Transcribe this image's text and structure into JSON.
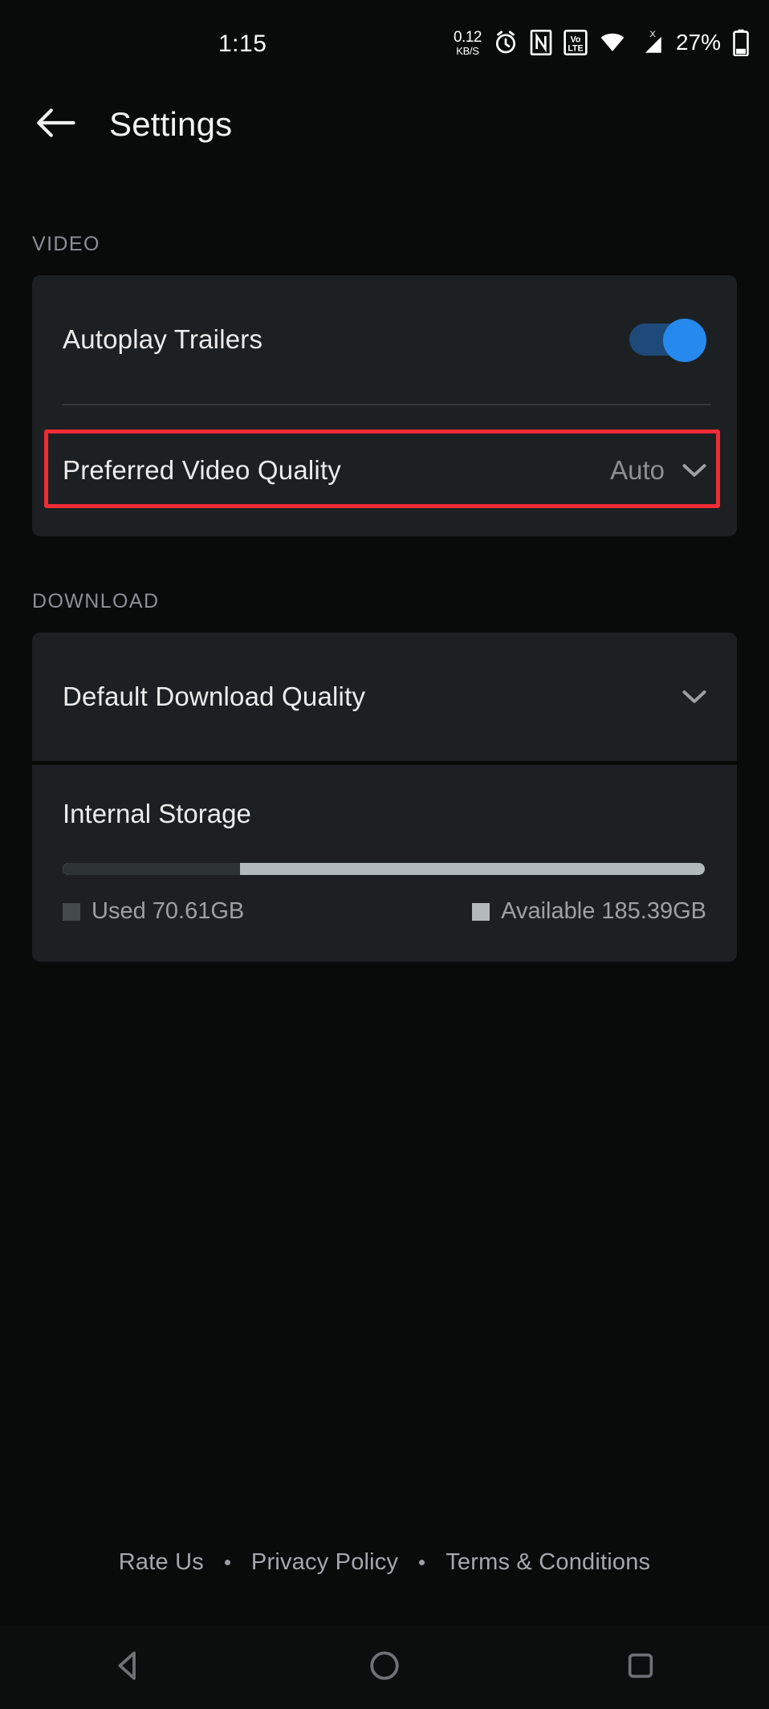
{
  "status_bar": {
    "time": "1:15",
    "network_speed_value": "0.12",
    "network_speed_unit": "KB/S",
    "alarm_icon": "alarm-clock-icon",
    "nfc_icon": "nfc-icon",
    "volte_icon": "volte-icon",
    "volte_top": "Vo",
    "volte_bottom": "LTE",
    "wifi_icon": "wifi-icon",
    "signal_icon": "cellular-signal-no-sim-icon",
    "signal_badge": "X",
    "battery_percent": "27%",
    "battery_icon": "battery-icon"
  },
  "appbar": {
    "back_icon": "arrow-left-icon",
    "title": "Settings"
  },
  "sections": [
    {
      "header": "VIDEO",
      "rows": [
        {
          "label": "Autoplay Trailers",
          "control": "toggle",
          "value": "",
          "toggle_on": true
        },
        {
          "label": "Preferred Video Quality",
          "control": "dropdown",
          "value": "Auto",
          "highlighted": true
        }
      ]
    },
    {
      "header": "DOWNLOAD",
      "rows": [
        {
          "label": "Default Download Quality",
          "control": "dropdown",
          "value": ""
        }
      ]
    }
  ],
  "storage": {
    "title": "Internal Storage",
    "used_label": "Used 70.61GB",
    "available_label": "Available 185.39GB",
    "used_percent": 27.6,
    "used_gb": 70.61,
    "available_gb": 185.39,
    "total_gb": 256.0,
    "used_color": "#2e3336",
    "available_color": "#b2babb"
  },
  "footer": {
    "links": [
      {
        "label": "Rate Us"
      },
      {
        "label": "Privacy Policy"
      },
      {
        "label": "Terms & Conditions"
      }
    ],
    "separator": "•"
  },
  "navbar": {
    "back": "nav-back-icon",
    "home": "nav-home-icon",
    "recents": "nav-recents-icon"
  },
  "colors": {
    "background": "#090b0b",
    "card": "#1c2023",
    "accent_toggle": "#2589ed",
    "highlight_border": "#ef2b36",
    "section_header_text": "#8c9095",
    "primary_text": "#ececec",
    "secondary_text": "#8b8f93"
  }
}
